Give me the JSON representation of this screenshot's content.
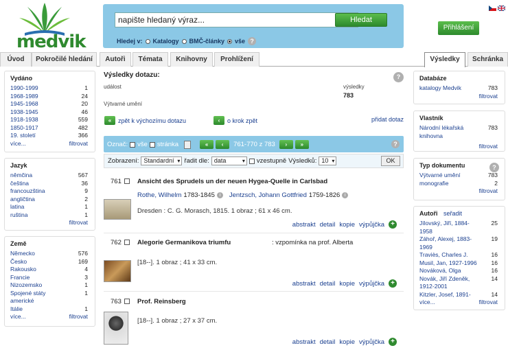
{
  "logo": {
    "text": "medvik"
  },
  "search": {
    "placeholder": "napište hledaný výraz...",
    "button": "Hledat",
    "in_label": "Hledej v:",
    "opt1": "Katalogy",
    "opt2": "BMČ-články",
    "opt3": "vše"
  },
  "login": "Přihlášení",
  "tabs": [
    "Úvod",
    "Pokročilé hledání",
    "Autoři",
    "Témata",
    "Knihovny",
    "Prohlížení"
  ],
  "tabs_right": [
    "Výsledky",
    "Schránka"
  ],
  "facets_left": [
    {
      "title": "Vydáno",
      "items": [
        [
          "1990-1999",
          "1"
        ],
        [
          "1968-1989",
          "24"
        ],
        [
          "1945-1968",
          "20"
        ],
        [
          "1938-1945",
          "46"
        ],
        [
          "1918-1938",
          "559"
        ],
        [
          "1850-1917",
          "482"
        ],
        [
          "19. století",
          "366"
        ]
      ],
      "more": "více...",
      "filter": "filtrovat"
    },
    {
      "title": "Jazyk",
      "items": [
        [
          "němčina",
          "567"
        ],
        [
          "čeština",
          "36"
        ],
        [
          "francouzština",
          "9"
        ],
        [
          "angličtina",
          "2"
        ],
        [
          "latina",
          "1"
        ],
        [
          "ruština",
          "1"
        ]
      ],
      "more": "",
      "filter": "filtrovat"
    },
    {
      "title": "Země",
      "items": [
        [
          "Německo",
          "576"
        ],
        [
          "Česko",
          "169"
        ],
        [
          "Rakousko",
          "4"
        ],
        [
          "Francie",
          "3"
        ],
        [
          "Nizozemsko",
          "1"
        ],
        [
          "Spojené státy americké",
          "1"
        ],
        [
          "Itálie",
          "1"
        ]
      ],
      "more": "více...",
      "filter": "filtrovat"
    }
  ],
  "results": {
    "title": "Výsledky dotazu:",
    "q1": "událost",
    "q1_label": "výsledky",
    "q1_count": "783",
    "q2": "Výtvarné umění",
    "back_start": "zpět k výchozímu dotazu",
    "back_step": "o krok zpět",
    "add_query": "přidat dotaz"
  },
  "nav": {
    "mark": "Označ:",
    "all": "vše",
    "page": "stránka",
    "range": "761-770 z 783"
  },
  "display": {
    "label": "Zobrazení:",
    "view": "Standardní",
    "sort_label": "řadit dle:",
    "sort": "data",
    "asc": "vzestupně",
    "per_label": "Výsledků:",
    "per": "10",
    "ok": "OK"
  },
  "records": [
    {
      "num": "761",
      "title": "Ansicht des Sprudels un der neuen Hygea-Quelle in Carlsbad",
      "authors": "Rothe, Wilhelm",
      "a1d": "1783-1845",
      "author2": "Jentzsch, Johann Gottfried",
      "a2d": "1759-1826",
      "desc": "Dresden : C. G. Morasch, 1815. 1 obraz ; 61 x 46 cm."
    },
    {
      "num": "762",
      "title": "Alegorie Germanikova triumfu",
      "subtitle": ": vzpomínka na prof. Alberta",
      "desc": "[18--]. 1 obraz ; 41 x 33 cm."
    },
    {
      "num": "763",
      "title": "Prof. Reinsberg",
      "desc": "[18--]. 1 obraz ; 27 x 37 cm."
    }
  ],
  "actions": [
    "abstrakt",
    "detail",
    "kopie",
    "výpůjčka"
  ],
  "facets_right": [
    {
      "title": "Databáze",
      "items": [
        [
          "katalogy Medvik",
          "783"
        ]
      ],
      "filter": "filtrovat"
    },
    {
      "title": "Vlastník",
      "items": [
        [
          "Národní lékařská knihovna",
          "783"
        ]
      ],
      "filter": "filtrovat"
    },
    {
      "title": "Typ dokumentu",
      "items": [
        [
          "Výtvarné umění",
          "783"
        ],
        [
          "monografie",
          "2"
        ]
      ],
      "filter": "filtrovat"
    },
    {
      "title": "Autoři",
      "sort": "seřadit",
      "items": [
        [
          "Jílovský, Jiří, 1884-1958",
          "25"
        ],
        [
          "Záhoř, Alexej, 1883-1969",
          "19"
        ],
        [
          "Traviès, Charles J.",
          "16"
        ],
        [
          "Musil, Jan, 1927-1996",
          "16"
        ],
        [
          "Nováková, Olga",
          "16"
        ],
        [
          "Novák, Jiří Zdeněk, 1912-2001",
          "14"
        ],
        [
          "Kitzler, Josef, 1891-",
          "14"
        ]
      ],
      "more": "více...",
      "filter": "filtrovat"
    }
  ]
}
